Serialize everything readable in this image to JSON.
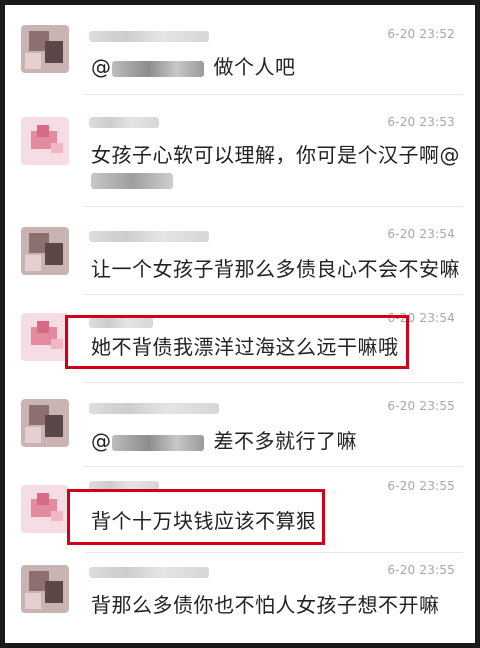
{
  "comments": [
    {
      "time": "6-20 23:52",
      "text": "做个人吧",
      "mention": "@"
    },
    {
      "time": "6-20 23:53",
      "text": "女孩子心软可以理解，你可是个汉子啊@"
    },
    {
      "time": "6-20 23:54",
      "text": "让一个女孩子背那么多债良心不会不安嘛"
    },
    {
      "time": "6-20 23:54",
      "text": "她不背债我漂洋过海这么远干嘛哦"
    },
    {
      "time": "6-20 23:55",
      "text": "差不多就行了嘛",
      "mention": "@"
    },
    {
      "time": "6-20 23:55",
      "text": "背个十万块钱应该不算狠"
    },
    {
      "time": "6-20 23:55",
      "text": "背那么多债你也不怕人女孩子想不开嘛"
    }
  ],
  "colors": {
    "highlight_border": "#d0021b",
    "timestamp": "#a8a8a8",
    "comment_text": "#222222"
  },
  "icons": [
    "avatar-pixelated",
    "avatar-pixelated-pink"
  ]
}
